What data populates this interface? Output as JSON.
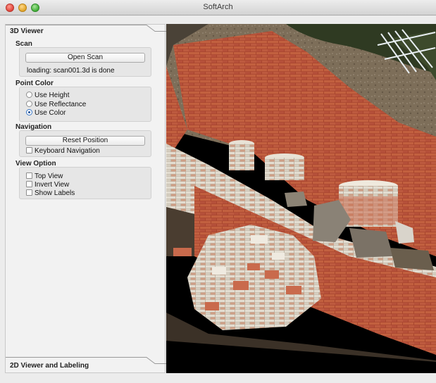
{
  "window": {
    "title": "SoftArch"
  },
  "panel": {
    "top_tab": "3D Viewer",
    "bottom_tab": "2D Viewer and Labeling",
    "scan": {
      "title": "Scan",
      "open_button": "Open Scan",
      "status": "loading: scan001.3d is done"
    },
    "point_color": {
      "title": "Point Color",
      "options": [
        {
          "label": "Use Height",
          "selected": false
        },
        {
          "label": "Use Reflectance",
          "selected": false
        },
        {
          "label": "Use Color",
          "selected": true
        }
      ]
    },
    "navigation": {
      "title": "Navigation",
      "reset_button": "Reset Position",
      "keyboard_label": "Keyboard Navigation"
    },
    "view_option": {
      "title": "View Option",
      "options": [
        {
          "label": "Top View",
          "checked": false
        },
        {
          "label": "Invert View",
          "checked": false
        },
        {
          "label": "Show Labels",
          "checked": false
        }
      ]
    }
  },
  "colors": {
    "brick": "#b8553a",
    "soil": "#7a6a55",
    "mortar": "#d8d2c4",
    "radio_accent": "#3a78c8"
  }
}
